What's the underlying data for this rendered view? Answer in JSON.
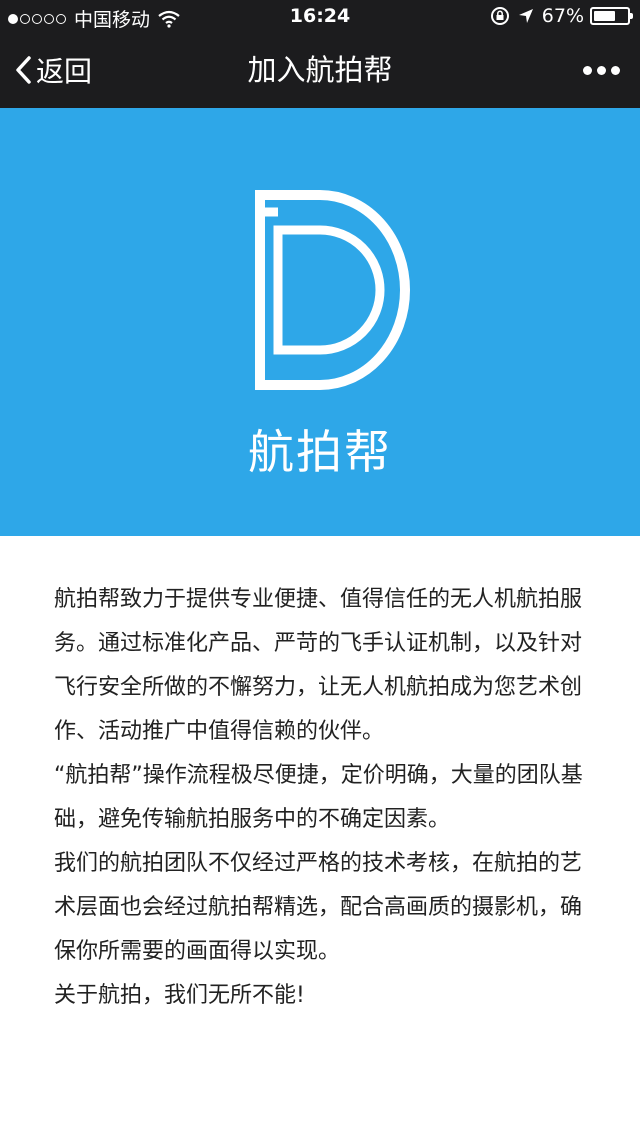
{
  "status_bar": {
    "carrier": "中国移动",
    "time": "16:24",
    "battery": "67%",
    "battery_level": 0.67
  },
  "nav": {
    "back_label": "返回",
    "title": "加入航拍帮"
  },
  "hero": {
    "brand": "航拍帮",
    "bg_color": "#2ea7e8"
  },
  "content": {
    "paragraphs": [
      "航拍帮致力于提供专业便捷、值得信任的无人机航拍服务。通过标准化产品、严苛的飞手认证机制，以及针对飞行安全所做的不懈努力，让无人机航拍成为您艺术创作、活动推广中值得信赖的伙伴。",
      "“航拍帮”操作流程极尽便捷，定价明确，大量的团队基础，避免传输航拍服务中的不确定因素。",
      "我们的航拍团队不仅经过严格的技术考核，在航拍的艺术层面也会经过航拍帮精选，配合高画质的摄影机，确保你所需要的画面得以实现。",
      "关于航拍，我们无所不能!"
    ]
  }
}
